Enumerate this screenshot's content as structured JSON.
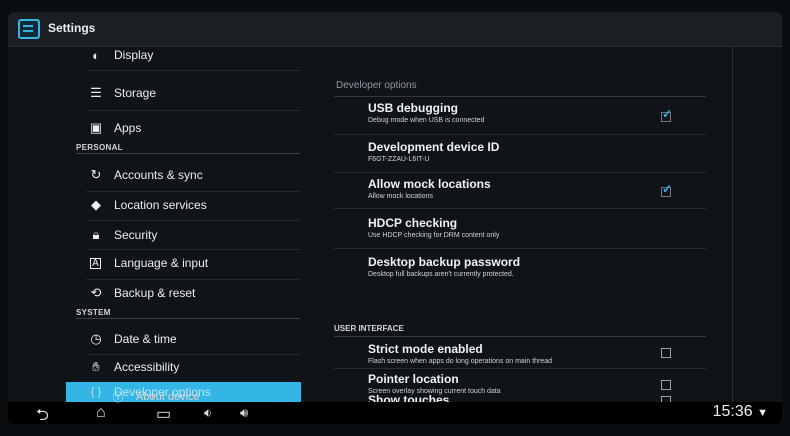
{
  "app": {
    "title": "Settings"
  },
  "left": {
    "items": [
      {
        "label": "Display",
        "icon": "display-icon"
      },
      {
        "label": "Storage",
        "icon": "storage-icon"
      },
      {
        "label": "Apps",
        "icon": "apps-icon"
      },
      {
        "label": "Accounts & sync",
        "icon": "sync-icon"
      },
      {
        "label": "Location services",
        "icon": "location-icon"
      },
      {
        "label": "Security",
        "icon": "lock-icon"
      },
      {
        "label": "Language & input",
        "icon": "language-icon"
      },
      {
        "label": "Backup & reset",
        "icon": "backup-icon"
      },
      {
        "label": "Date & time",
        "icon": "clock-icon"
      },
      {
        "label": "Accessibility",
        "icon": "hand-icon"
      },
      {
        "label": "Developer options",
        "icon": "braces-icon"
      },
      {
        "label": "About device",
        "icon": "info-icon"
      }
    ],
    "sections": {
      "personal": "PERSONAL",
      "system": "SYSTEM"
    }
  },
  "right": {
    "header": "Developer options",
    "items": [
      {
        "title": "USB debugging",
        "subtitle": "Debug mode when USB is connected",
        "checked": true
      },
      {
        "title": "Development device ID",
        "subtitle": "F6GT-ZZAU-L6IT-U",
        "checked": null
      },
      {
        "title": "Allow mock locations",
        "subtitle": "Allow mock locations",
        "checked": true
      },
      {
        "title": "HDCP checking",
        "subtitle": "Use HDCP checking for DRM content only",
        "checked": null
      },
      {
        "title": "Desktop backup password",
        "subtitle": "Desktop full backups aren't currently protected.",
        "checked": null
      },
      {
        "title": "Strict mode enabled",
        "subtitle": "Flash screen when apps do long operations on main thread",
        "checked": false
      },
      {
        "title": "Pointer location",
        "subtitle": "Screen overlay showing current touch data",
        "checked": false
      },
      {
        "title": "Show touches",
        "subtitle": "",
        "checked": false
      }
    ],
    "user_interface_section": "USER INTERFACE"
  },
  "status": {
    "time": "15:36"
  },
  "colors": {
    "accent": "#33b5e5",
    "background": "#101317"
  }
}
